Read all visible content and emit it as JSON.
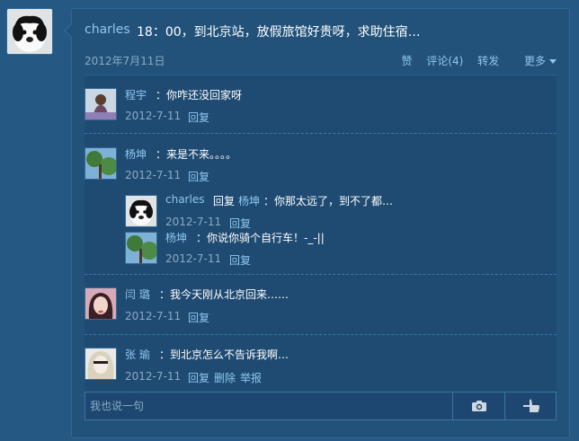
{
  "post": {
    "author": "charles",
    "text": "18：00，到北京站，放假旅馆好贵呀，求助住宿…",
    "date": "2012年7月11日",
    "actions": {
      "like": "赞",
      "comment": "评论(4)",
      "repost": "转发",
      "more": "更多"
    }
  },
  "comments": [
    {
      "name": "程宇",
      "text": "：你咋还没回家呀",
      "date": "2012-7-11",
      "actions": [
        "回复"
      ],
      "avatar_icon": "girl-avatar-icon"
    },
    {
      "name": "杨坤",
      "text": "：来是不来。。。。",
      "date": "2012-7-11",
      "actions": [
        "回复"
      ],
      "avatar_icon": "tree-avatar-icon",
      "replies": [
        {
          "name": "charles",
          "reply_word": "回复",
          "reply_to": "杨坤",
          "text": "：你那太远了，到不了都…",
          "date": "2012-7-11",
          "action": "回复",
          "avatar_icon": "dog-avatar-icon"
        },
        {
          "name": "杨坤",
          "text": "：你说你骑个自行车！-_-||",
          "date": "2012-7-11",
          "action": "回复",
          "avatar_icon": "tree-avatar-icon"
        }
      ]
    },
    {
      "name": "闫 璐",
      "text": "：我今天刚从北京回来……",
      "date": "2012-7-11",
      "actions": [
        "回复"
      ],
      "avatar_icon": "pink-avatar-icon"
    },
    {
      "name": "张 瑜",
      "text": "：到北京怎么不告诉我啊…",
      "date": "2012-7-11",
      "actions": [
        "回复",
        "删除",
        "举报"
      ],
      "avatar_icon": "blonde-avatar-icon"
    }
  ],
  "reply_box": {
    "placeholder": "我也说一句",
    "camera_icon": "camera-icon",
    "send_icon": "thumb-hand-icon"
  },
  "colors": {
    "background": "#255882",
    "link": "#8fc7ef",
    "muted": "#8aaac4"
  }
}
